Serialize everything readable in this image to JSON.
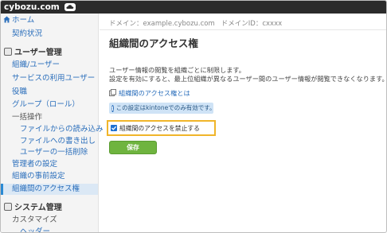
{
  "header": {
    "logo": "cybozu.com"
  },
  "sidebar": {
    "home": "ホーム",
    "contract": "契約状況",
    "user_section": "ユーザー管理",
    "items": [
      "組織/ユーザー",
      "サービスの利用ユーザー",
      "役職",
      "グループ（ロール）",
      "一括操作",
      "ファイルからの読み込み",
      "ファイルへの書き出し",
      "ユーザーの一括削除",
      "管理者の設定",
      "組織の事前設定",
      "組織間のアクセス権"
    ],
    "system_section": "システム管理",
    "system_items": [
      "カスタマイズ",
      "ヘッダー"
    ]
  },
  "main": {
    "domain_label": "ドメイン：example.cybozu.com",
    "domain_id_label": "ドメインID：cxxxx",
    "title": "組織間のアクセス権",
    "desc_line1": "ユーザー情報の閲覧を組織ごとに制限します。",
    "desc_line2": "設定を有効にすると、最上位組織が異なるユーザー間のユーザー情報が閲覧できなくなります。",
    "help_link": "組織間のアクセス権とは",
    "notice": "この設定はkintoneでのみ有効です。",
    "checkbox_label": "組織間のアクセスを禁止する",
    "checkbox_checked": true,
    "save_label": "保存"
  },
  "colors": {
    "link": "#2a6ebb",
    "save_button": "#6fb43f",
    "highlight_border": "#f0b52a",
    "notice_bg": "#cfe3f6"
  }
}
